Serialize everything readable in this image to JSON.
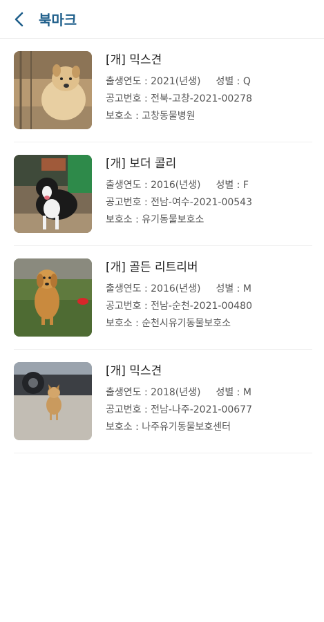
{
  "header": {
    "title": "북마크",
    "back_icon": "chevron-left-icon",
    "accent_color": "#1f5f8b"
  },
  "labels": {
    "birth": "출생연도 : ",
    "gender": "성별 : ",
    "notice": "공고번호 : ",
    "shelter": "보호소 : "
  },
  "items": [
    {
      "title": "[개] 믹스견",
      "birth": "2021(년생)",
      "gender": "Q",
      "notice": "전북-고창-2021-00278",
      "shelter": "고창동물병원"
    },
    {
      "title": "[개] 보더 콜리",
      "birth": "2016(년생)",
      "gender": "F",
      "notice": "전남-여수-2021-00543",
      "shelter": "유기동물보호소"
    },
    {
      "title": "[개] 골든 리트리버",
      "birth": "2016(년생)",
      "gender": "M",
      "notice": "전남-순천-2021-00480",
      "shelter": "순천시유기동물보호소"
    },
    {
      "title": "[개] 믹스견",
      "birth": "2018(년생)",
      "gender": "M",
      "notice": "전남-나주-2021-00677",
      "shelter": "나주유기동물보호센터"
    }
  ]
}
